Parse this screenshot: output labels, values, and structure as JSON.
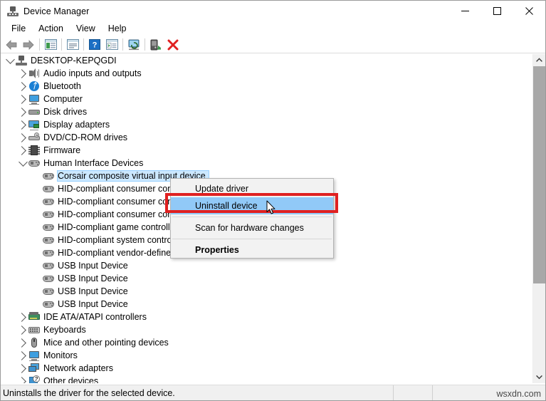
{
  "window": {
    "title": "Device Manager",
    "icon": "device-manager-icon",
    "minimize_label": "—",
    "maximize_label": "□",
    "close_label": "✕"
  },
  "menubar": {
    "items": [
      {
        "label": "File"
      },
      {
        "label": "Action"
      },
      {
        "label": "View"
      },
      {
        "label": "Help"
      }
    ]
  },
  "toolbar": {
    "buttons": [
      {
        "name": "back-icon",
        "tooltip": "Back"
      },
      {
        "name": "forward-icon",
        "tooltip": "Forward"
      },
      {
        "name": "show-hide-console-tree-icon",
        "tooltip": "Show/hide console tree"
      },
      {
        "name": "properties-icon",
        "tooltip": "Properties"
      },
      {
        "name": "help-icon",
        "tooltip": "Help"
      },
      {
        "name": "view-icon",
        "tooltip": "View"
      },
      {
        "name": "scan-hardware-changes-icon",
        "tooltip": "Scan for hardware changes"
      },
      {
        "name": "update-driver-icon",
        "tooltip": "Update driver"
      },
      {
        "name": "uninstall-device-icon",
        "tooltip": "Uninstall device"
      }
    ]
  },
  "tree": {
    "root": {
      "label": "DESKTOP-KEPQGDI",
      "icon": "computer-icon",
      "expanded": true
    },
    "items": [
      {
        "label": "Audio inputs and outputs",
        "icon": "speaker-icon",
        "indent": 1,
        "expandable": true,
        "expanded": false,
        "selected": false
      },
      {
        "label": "Bluetooth",
        "icon": "bluetooth-icon",
        "indent": 1,
        "expandable": true,
        "expanded": false,
        "selected": false
      },
      {
        "label": "Computer",
        "icon": "monitor-icon",
        "indent": 1,
        "expandable": true,
        "expanded": false,
        "selected": false
      },
      {
        "label": "Disk drives",
        "icon": "disk-drive-icon",
        "indent": 1,
        "expandable": true,
        "expanded": false,
        "selected": false
      },
      {
        "label": "Display adapters",
        "icon": "display-adapter-icon",
        "indent": 1,
        "expandable": true,
        "expanded": false,
        "selected": false
      },
      {
        "label": "DVD/CD-ROM drives",
        "icon": "dvd-drive-icon",
        "indent": 1,
        "expandable": true,
        "expanded": false,
        "selected": false
      },
      {
        "label": "Firmware",
        "icon": "firmware-chip-icon",
        "indent": 1,
        "expandable": true,
        "expanded": false,
        "selected": false
      },
      {
        "label": "Human Interface Devices",
        "icon": "hid-icon",
        "indent": 1,
        "expandable": true,
        "expanded": true,
        "selected": false
      },
      {
        "label": "Corsair composite virtual input device",
        "icon": "hid-icon",
        "indent": 2,
        "expandable": false,
        "expanded": false,
        "selected": true
      },
      {
        "label": "HID-compliant consumer control device",
        "icon": "hid-icon",
        "indent": 2,
        "expandable": false,
        "expanded": false,
        "selected": false
      },
      {
        "label": "HID-compliant consumer control device",
        "icon": "hid-icon",
        "indent": 2,
        "expandable": false,
        "expanded": false,
        "selected": false
      },
      {
        "label": "HID-compliant consumer control device",
        "icon": "hid-icon",
        "indent": 2,
        "expandable": false,
        "expanded": false,
        "selected": false
      },
      {
        "label": "HID-compliant game controller",
        "icon": "hid-icon",
        "indent": 2,
        "expandable": false,
        "expanded": false,
        "selected": false
      },
      {
        "label": "HID-compliant system controller",
        "icon": "hid-icon",
        "indent": 2,
        "expandable": false,
        "expanded": false,
        "selected": false
      },
      {
        "label": "HID-compliant vendor-defined device",
        "icon": "hid-icon",
        "indent": 2,
        "expandable": false,
        "expanded": false,
        "selected": false
      },
      {
        "label": "USB Input Device",
        "icon": "hid-icon",
        "indent": 2,
        "expandable": false,
        "expanded": false,
        "selected": false
      },
      {
        "label": "USB Input Device",
        "icon": "hid-icon",
        "indent": 2,
        "expandable": false,
        "expanded": false,
        "selected": false
      },
      {
        "label": "USB Input Device",
        "icon": "hid-icon",
        "indent": 2,
        "expandable": false,
        "expanded": false,
        "selected": false
      },
      {
        "label": "USB Input Device",
        "icon": "hid-icon",
        "indent": 2,
        "expandable": false,
        "expanded": false,
        "selected": false
      },
      {
        "label": "IDE ATA/ATAPI controllers",
        "icon": "ide-controller-icon",
        "indent": 1,
        "expandable": true,
        "expanded": false,
        "selected": false
      },
      {
        "label": "Keyboards",
        "icon": "keyboard-icon",
        "indent": 1,
        "expandable": true,
        "expanded": false,
        "selected": false
      },
      {
        "label": "Mice and other pointing devices",
        "icon": "mouse-icon",
        "indent": 1,
        "expandable": true,
        "expanded": false,
        "selected": false
      },
      {
        "label": "Monitors",
        "icon": "monitor-icon",
        "indent": 1,
        "expandable": true,
        "expanded": false,
        "selected": false
      },
      {
        "label": "Network adapters",
        "icon": "network-adapter-icon",
        "indent": 1,
        "expandable": true,
        "expanded": false,
        "selected": false
      },
      {
        "label": "Other devices",
        "icon": "other-devices-icon",
        "indent": 1,
        "expandable": true,
        "expanded": false,
        "selected": false
      }
    ]
  },
  "context_menu": {
    "items": [
      {
        "label": "Update driver",
        "highlighted": false,
        "bold": false,
        "separator_after": false
      },
      {
        "label": "Uninstall device",
        "highlighted": true,
        "bold": false,
        "separator_after": true
      },
      {
        "label": "Scan for hardware changes",
        "highlighted": false,
        "bold": false,
        "separator_after": true
      },
      {
        "label": "Properties",
        "highlighted": false,
        "bold": true,
        "separator_after": false
      }
    ],
    "highlight_color": "#91c9f7",
    "annotation_box_color": "#e02020"
  },
  "statusbar": {
    "message": "Uninstalls the driver for the selected device.",
    "panel2": "",
    "panel3": ""
  },
  "watermark": {
    "text": "wsxdn.com"
  }
}
